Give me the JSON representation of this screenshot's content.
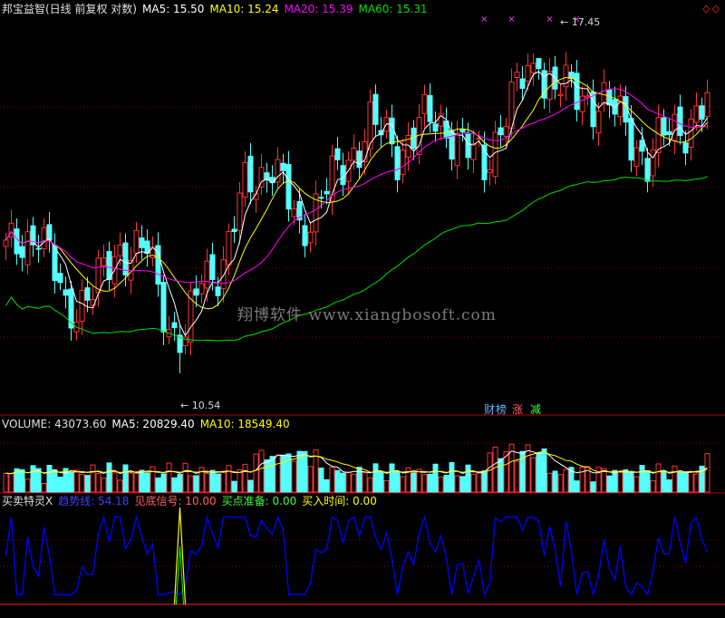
{
  "panels": {
    "main": {
      "name": "邦宝益智(日线 前复权 对数)",
      "ma5_label": "MA5: 15.50",
      "ma10_label": "MA10: 15.24",
      "ma20_label": "MA20: 15.39",
      "ma60_label": "MA60: 15.31",
      "high_label": "17.45",
      "low_label": "10.54",
      "badges": [
        "财",
        "榜",
        "涨",
        "减"
      ],
      "corner": "◇◇"
    },
    "volume": {
      "volume_label": "VOLUME: 43073.60",
      "ma5_label": "MA5: 20829.40",
      "ma10_label": "MA10: 18549.40"
    },
    "indicator": {
      "name": "买卖特灵X",
      "trend_label": "趋势线: 54.18",
      "bottom_label": "见底信号: 10.00",
      "buy_ready_label": "买点准备: 0.00",
      "buy_time_label": "买入时间: 0.00"
    }
  },
  "watermark": "翔博软件 www.xiangbosoft.com",
  "colors": {
    "up": "#ff3232",
    "down": "#54ffff",
    "ma5": "#ffffff",
    "ma10": "#ffff00",
    "ma20": "#ff00ff",
    "ma60": "#00e000",
    "trend": "#0000ff",
    "signal": "#ffff00",
    "grid": "#800000",
    "frame": "#b00000"
  },
  "chart_data": [
    {
      "type": "candlestick",
      "title": "邦宝益智(日线 前复权 对数)",
      "ylim": [
        9.9,
        18.6
      ],
      "yscale": "log",
      "series_note_ma": [
        "MA5",
        "MA10",
        "MA20",
        "MA60"
      ],
      "high": 17.45,
      "low": 10.54
    },
    {
      "type": "bar",
      "title": "VOLUME",
      "ylim": [
        0,
        70000
      ],
      "last_value": 43073.6
    },
    {
      "type": "line",
      "title": "买卖特灵X",
      "series": [
        {
          "name": "趋势线",
          "last": 54.18
        },
        {
          "name": "见底信号",
          "last": 10.0
        }
      ],
      "ylim": [
        0,
        100
      ]
    }
  ]
}
